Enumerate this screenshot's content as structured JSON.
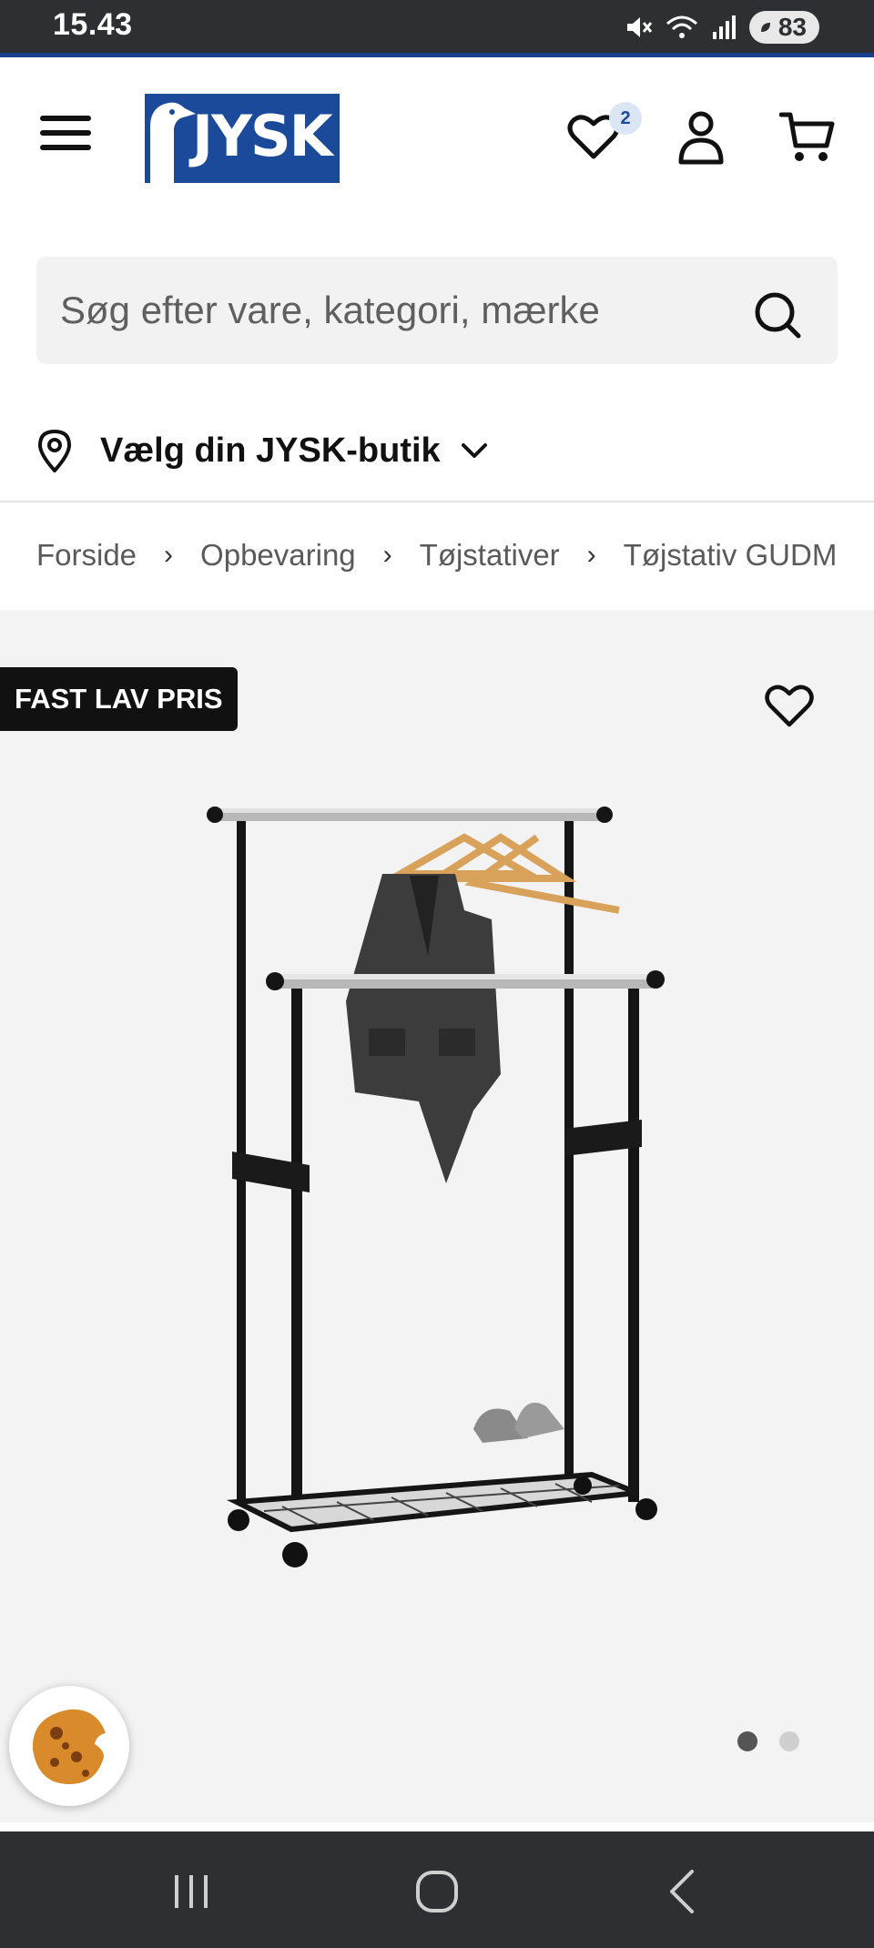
{
  "status_bar": {
    "time": "15.43",
    "battery": "83"
  },
  "header": {
    "logo_text": "JYSK",
    "wishlist_count": "2"
  },
  "search": {
    "placeholder": "Søg efter vare, kategori, mærke"
  },
  "store_selector": {
    "label": "Vælg din JYSK-butik"
  },
  "breadcrumb": [
    "Forside",
    "Opbevaring",
    "Tøjstativer",
    "Tøjstativ GUDME dobbelt"
  ],
  "product": {
    "badge": "FAST LAV PRIS",
    "carousel": {
      "total_images": 2,
      "active_index": 0
    }
  },
  "colors": {
    "brand_blue": "#1b4a9b",
    "status_bar_bg": "#2d2f33",
    "badge_bg": "#111111"
  }
}
